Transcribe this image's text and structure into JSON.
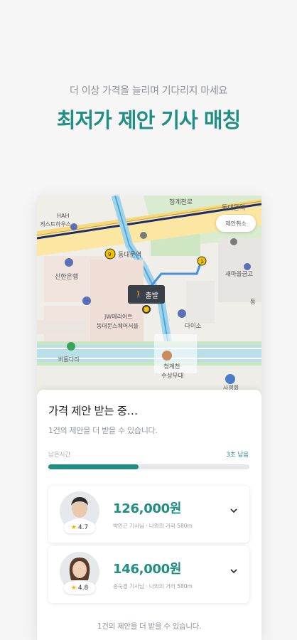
{
  "promo": {
    "subtitle": "더 이상 가격을 늘리며 기다리지 마세요",
    "headline": "최저가 제안 기사 매칭"
  },
  "map": {
    "cancel_label": "제안취소",
    "depart_label": "출발",
    "labels": {
      "top_road": "청계천로",
      "dongdaemun_station_right": "동대문역",
      "hah": "HAH",
      "guesthouse": "게스트하우스",
      "dongdaemun_station": "동대문역",
      "shinhan": "신한은행",
      "saemaeul": "새마을금고",
      "jw": "JW메리어트",
      "jw2": "동대문스퀘어서울",
      "daiso": "다이소",
      "pasture": "버들다리",
      "cheonggye": "청계천",
      "stage": "수상무대",
      "dong": "동",
      "bottom_right": "사명회",
      "station_num1": "9",
      "station_num2": "1"
    }
  },
  "sheet": {
    "title": "가격 제안 받는 중…",
    "subtitle": "1건의 제안을 더 받을 수 있습니다.",
    "time_label": "남은시간",
    "time_remaining": "3초 남음",
    "progress": 0.45,
    "footer": "1건의 제안을 더 받을 수 있습니다."
  },
  "offers": [
    {
      "price": "126,000원",
      "rating": "4.7",
      "meta": "박인근 기사님 · 나와의 거리 580m"
    },
    {
      "price": "146,000원",
      "rating": "4.8",
      "meta": "송숙경 기사님 · 나와의 거리 580m"
    }
  ],
  "colors": {
    "accent": "#1f8f84",
    "star": "#f5b800"
  }
}
